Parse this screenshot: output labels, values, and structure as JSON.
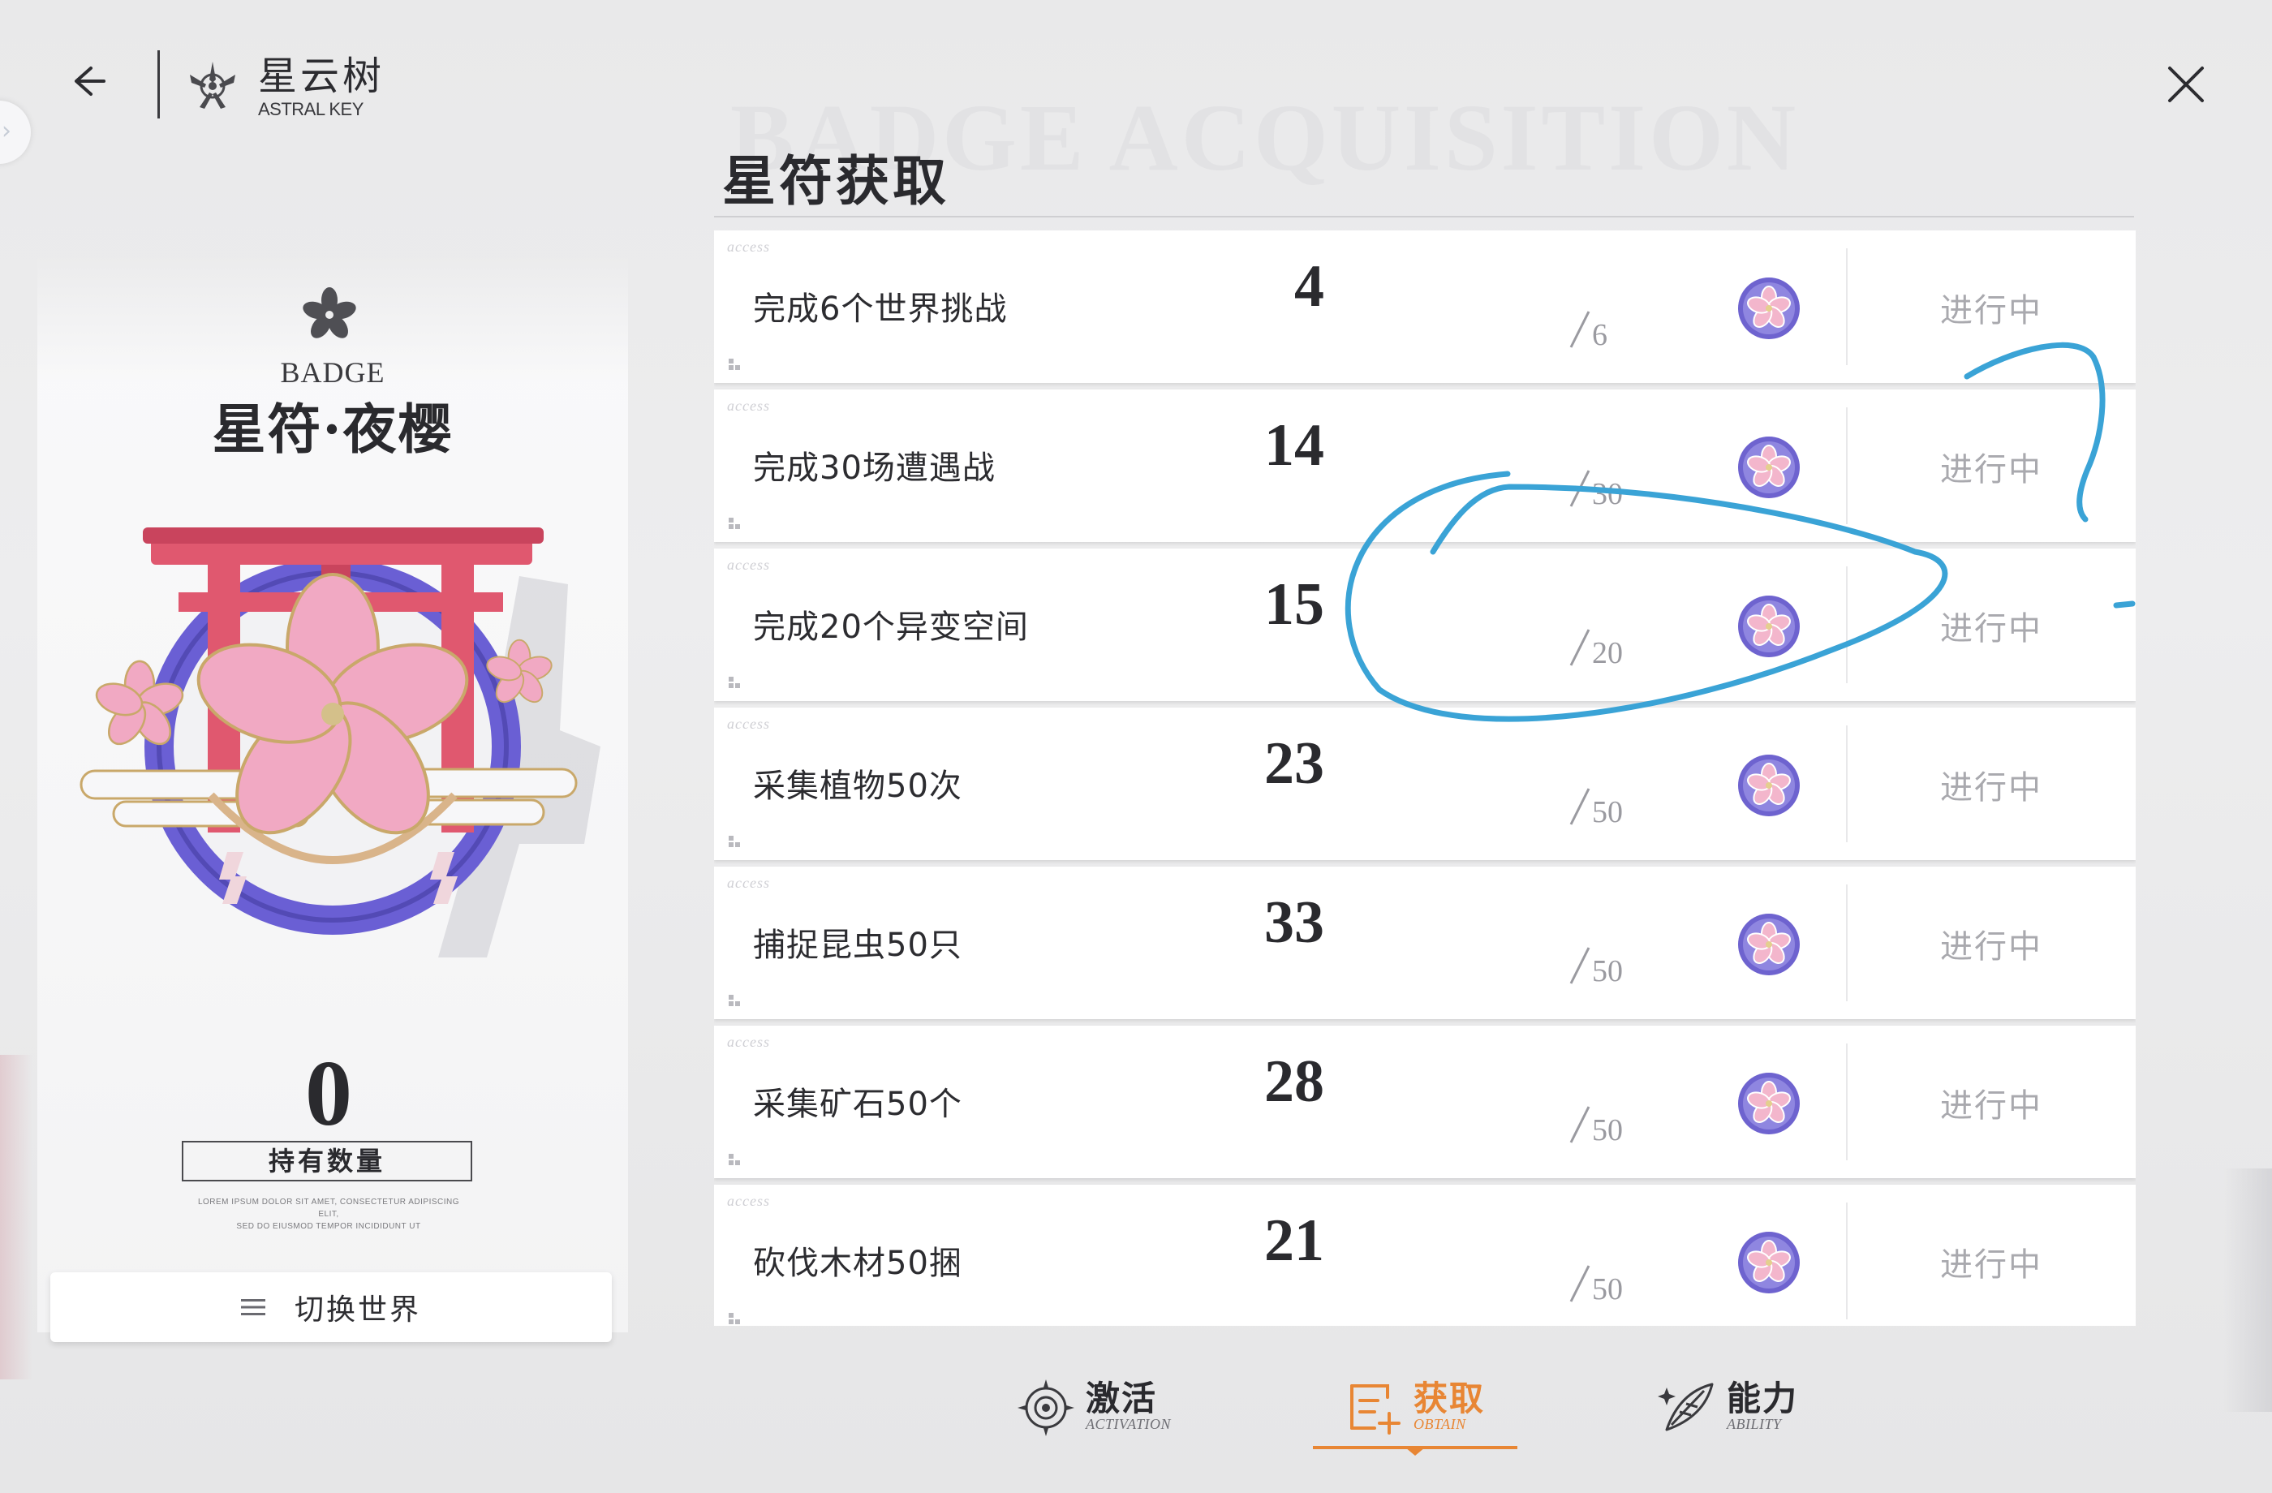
{
  "header": {
    "title": "星云树",
    "subtitle": "ASTRAL KEY"
  },
  "badge": {
    "eyebrow": "BADGE",
    "name": "星符·夜樱",
    "owned_count": "0",
    "owned_label": "持有数量",
    "note_line1": "LOREM IPSUM DOLOR SIT AMET, CONSECTETUR ADIPISCING ELIT,",
    "note_line2": "SED DO EIUSMOD TEMPOR INCIDIDUNT UT",
    "switch_world_label": "切换世界"
  },
  "section": {
    "watermark": "BADGE ACQUISITION",
    "title": "星符获取"
  },
  "tasks": [
    {
      "tag": "access",
      "text": "完成6个世界挑战",
      "current": "4",
      "total": "6",
      "status": "进行中"
    },
    {
      "tag": "access",
      "text": "完成30场遭遇战",
      "current": "14",
      "total": "30",
      "status": "进行中"
    },
    {
      "tag": "access",
      "text": "完成20个异变空间",
      "current": "15",
      "total": "20",
      "status": "进行中"
    },
    {
      "tag": "access",
      "text": "采集植物50次",
      "current": "23",
      "total": "50",
      "status": "进行中"
    },
    {
      "tag": "access",
      "text": "捕捉昆虫50只",
      "current": "33",
      "total": "50",
      "status": "进行中"
    },
    {
      "tag": "access",
      "text": "采集矿石50个",
      "current": "28",
      "total": "50",
      "status": "进行中"
    },
    {
      "tag": "access",
      "text": "砍伐木材50捆",
      "current": "21",
      "total": "50",
      "status": "进行中"
    }
  ],
  "nav": {
    "items": [
      {
        "label": "激活",
        "sub": "ACTIVATION",
        "icon": "activation-icon",
        "active": false
      },
      {
        "label": "获取",
        "sub": "OBTAIN",
        "icon": "obtain-icon",
        "active": true
      },
      {
        "label": "能力",
        "sub": "ABILITY",
        "icon": "ability-icon",
        "active": false
      }
    ]
  },
  "colors": {
    "accent": "#e88634",
    "annotation": "#3aa3d6",
    "torii_red": "#e0586f",
    "sakura_pink": "#f1a9c3",
    "ring_blue": "#5a4fc9"
  }
}
